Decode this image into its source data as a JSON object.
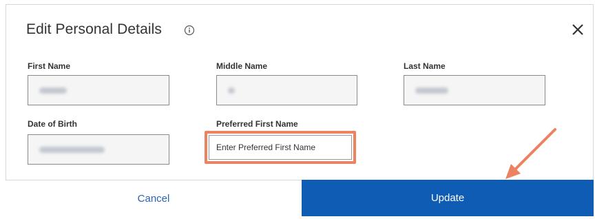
{
  "dialog": {
    "title": "Edit Personal Details",
    "info_icon": "info-circle-icon",
    "close_icon": "close-x-icon"
  },
  "fields": {
    "first_name": {
      "label": "First Name",
      "value": ""
    },
    "middle_name": {
      "label": "Middle Name",
      "value": ""
    },
    "last_name": {
      "label": "Last Name",
      "value": ""
    },
    "date_of_birth": {
      "label": "Date of Birth",
      "value": ""
    },
    "preferred_first_name": {
      "label": "Preferred First Name",
      "placeholder": "Enter Preferred First Name",
      "value": ""
    }
  },
  "footer": {
    "cancel_label": "Cancel",
    "update_label": "Update"
  },
  "colors": {
    "accent": "#0f5cb5",
    "cancel_text": "#2a63b7",
    "highlight": "#ec8262",
    "annotation_arrow": "#ec8262"
  }
}
